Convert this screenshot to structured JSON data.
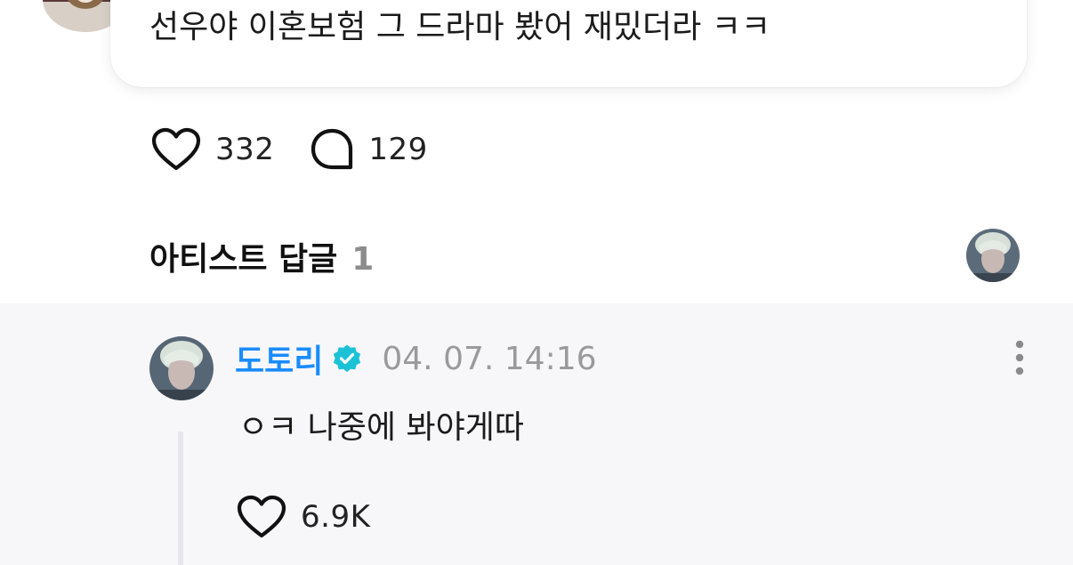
{
  "post": {
    "text": "선우야 이혼보험 그 드라마 봤어 재밌더라 ㅋㅋ",
    "like_icon": "heart-outline-icon",
    "like_count": "332",
    "comment_icon": "speech-bubble-icon",
    "comment_count": "129"
  },
  "artist_replies": {
    "title": "아티스트 답글",
    "count": "1"
  },
  "reply": {
    "author": "도토리",
    "verified_icon": "verified-badge-icon",
    "verified_color": "#1bc2d6",
    "author_color": "#1a8cff",
    "timestamp": "04. 07. 14:16",
    "text": "ㅇㅋ 나중에 봐야게따",
    "like_count": "6.9K"
  },
  "colors": {
    "reply_background": "#f7f7fa",
    "muted_text": "#9a9a9a"
  }
}
